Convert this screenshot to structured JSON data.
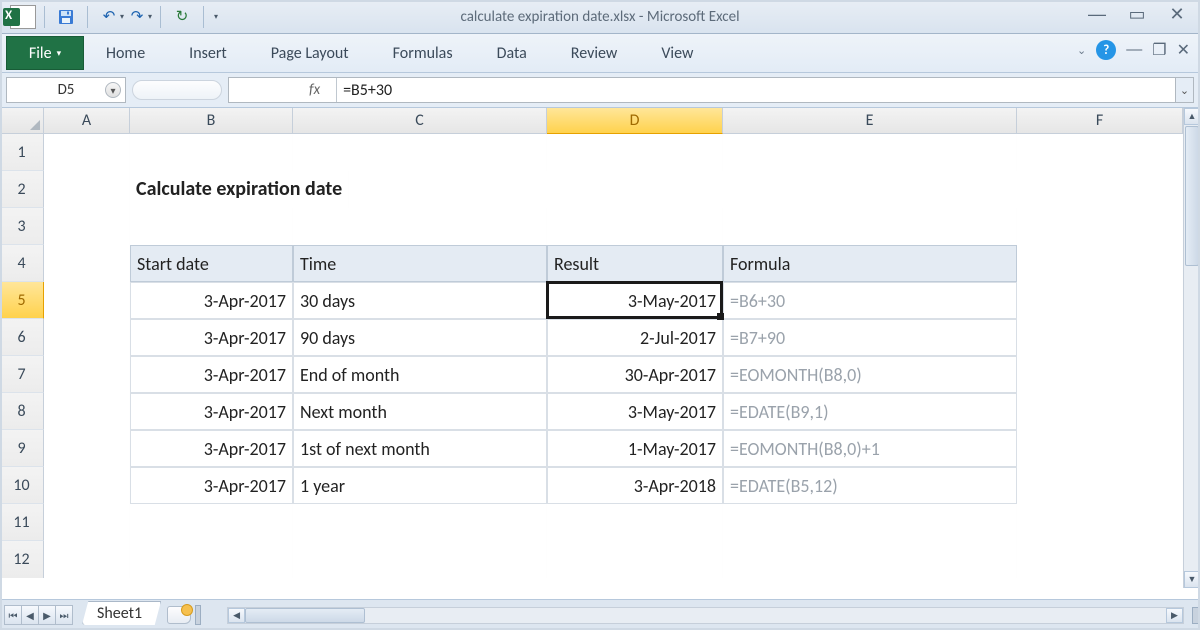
{
  "window": {
    "title": "calculate expiration date.xlsx  -  Microsoft Excel",
    "excel_x": "X"
  },
  "ribbon": {
    "file": "File",
    "tabs": [
      "Home",
      "Insert",
      "Page Layout",
      "Formulas",
      "Data",
      "Review",
      "View"
    ]
  },
  "formula_bar": {
    "namebox": "D5",
    "fx": "fx",
    "formula": "=B5+30"
  },
  "columns": [
    "A",
    "B",
    "C",
    "D",
    "E",
    "F"
  ],
  "rows": [
    "1",
    "2",
    "3",
    "4",
    "5",
    "6",
    "7",
    "8",
    "9",
    "10",
    "11",
    "12"
  ],
  "selected": {
    "col": "D",
    "row": "5"
  },
  "content": {
    "title": "Calculate expiration date",
    "headers": {
      "start": "Start date",
      "time": "Time",
      "result": "Result",
      "formula": "Formula"
    },
    "data": [
      {
        "start": "3-Apr-2017",
        "time": "30 days",
        "result": "3-May-2017",
        "formula": "=B6+30"
      },
      {
        "start": "3-Apr-2017",
        "time": "90 days",
        "result": "2-Jul-2017",
        "formula": "=B7+90"
      },
      {
        "start": "3-Apr-2017",
        "time": "End of month",
        "result": "30-Apr-2017",
        "formula": "=EOMONTH(B8,0)"
      },
      {
        "start": "3-Apr-2017",
        "time": "Next month",
        "result": "3-May-2017",
        "formula": "=EDATE(B9,1)"
      },
      {
        "start": "3-Apr-2017",
        "time": "1st of next month",
        "result": "1-May-2017",
        "formula": "=EOMONTH(B8,0)+1"
      },
      {
        "start": "3-Apr-2017",
        "time": "1 year",
        "result": "3-Apr-2018",
        "formula": "=EDATE(B5,12)"
      }
    ]
  },
  "sheet": {
    "name": "Sheet1"
  }
}
